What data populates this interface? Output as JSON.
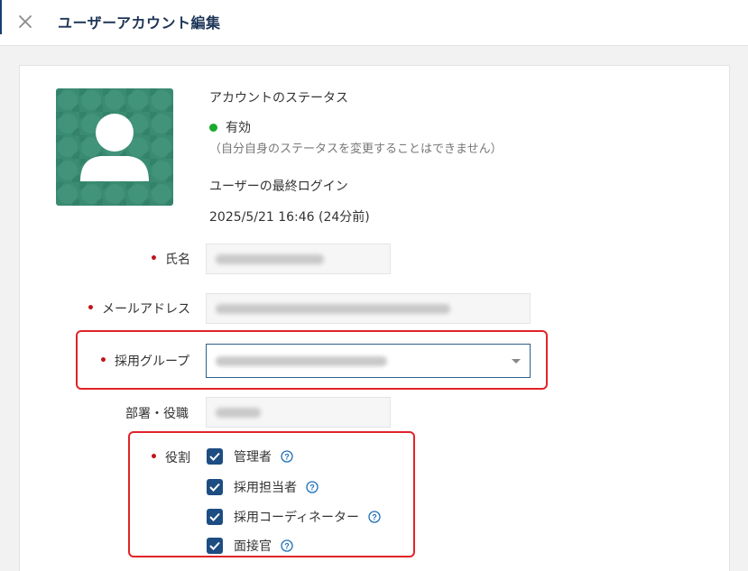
{
  "header": {
    "title": "ユーザーアカウント編集",
    "close_icon": "close-icon"
  },
  "profile": {
    "avatar_icon": "user-avatar-icon",
    "avatar_color": "#3a8b72",
    "status_heading": "アカウントのステータス",
    "status_value": "有効",
    "status_color": "#1aaa2c",
    "status_note": "（自分自身のステータスを変更することはできません）",
    "last_login_heading": "ユーザーの最終ログイン",
    "last_login_value": "2025/5/21 16:46 (24分前)"
  },
  "form": {
    "required_mark": "•",
    "name_label": "氏名",
    "email_label": "メールアドレス",
    "group_label": "採用グループ",
    "department_label": "部署・役職",
    "roles_label": "役割"
  },
  "roles": [
    {
      "label": "管理者",
      "checked": true
    },
    {
      "label": "採用担当者",
      "checked": true
    },
    {
      "label": "採用コーディネーター",
      "checked": true
    },
    {
      "label": "面接官",
      "checked": true
    }
  ],
  "colors": {
    "accent": "#1d4d82",
    "required": "#c0151b",
    "highlight": "#e0242a"
  }
}
